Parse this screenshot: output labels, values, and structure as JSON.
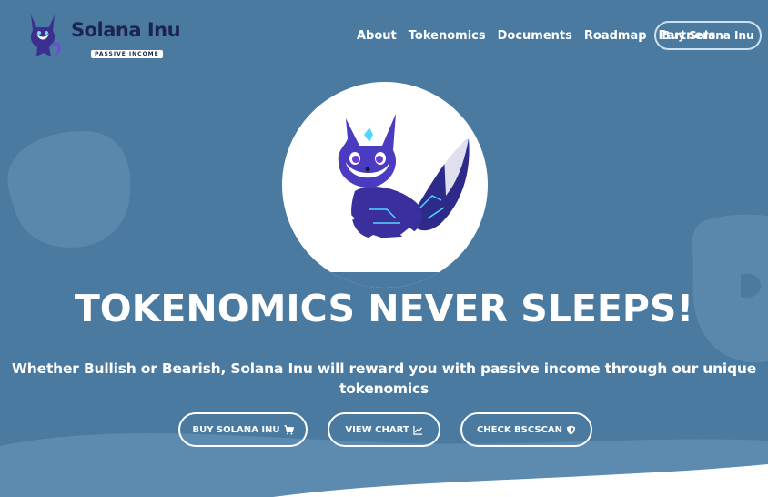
{
  "brand": {
    "name": "Solana Inu",
    "tagline": "PASSIVE INCOME"
  },
  "nav": {
    "items": [
      "About",
      "Tokenomics",
      "Documents",
      "Roadmap",
      "Partners"
    ],
    "cta_label": "Buy Solana Inu"
  },
  "hero": {
    "title": "TOKENOMICS NEVER SLEEPS!",
    "subtitle": "Whether Bullish or Bearish, Solana Inu will reward you with passive income through our unique tokenomics",
    "buttons": [
      {
        "label": "BUY SOLANA INU",
        "icon": "cart-icon"
      },
      {
        "label": "VIEW CHART",
        "icon": "chart-icon"
      },
      {
        "label": "CHECK BSCSCAN",
        "icon": "shield-icon"
      }
    ]
  },
  "colors": {
    "background": "#4a7aa0",
    "brand_text": "#1c2452",
    "wave": "#5d8bb0",
    "button_border": "#ffffff"
  }
}
